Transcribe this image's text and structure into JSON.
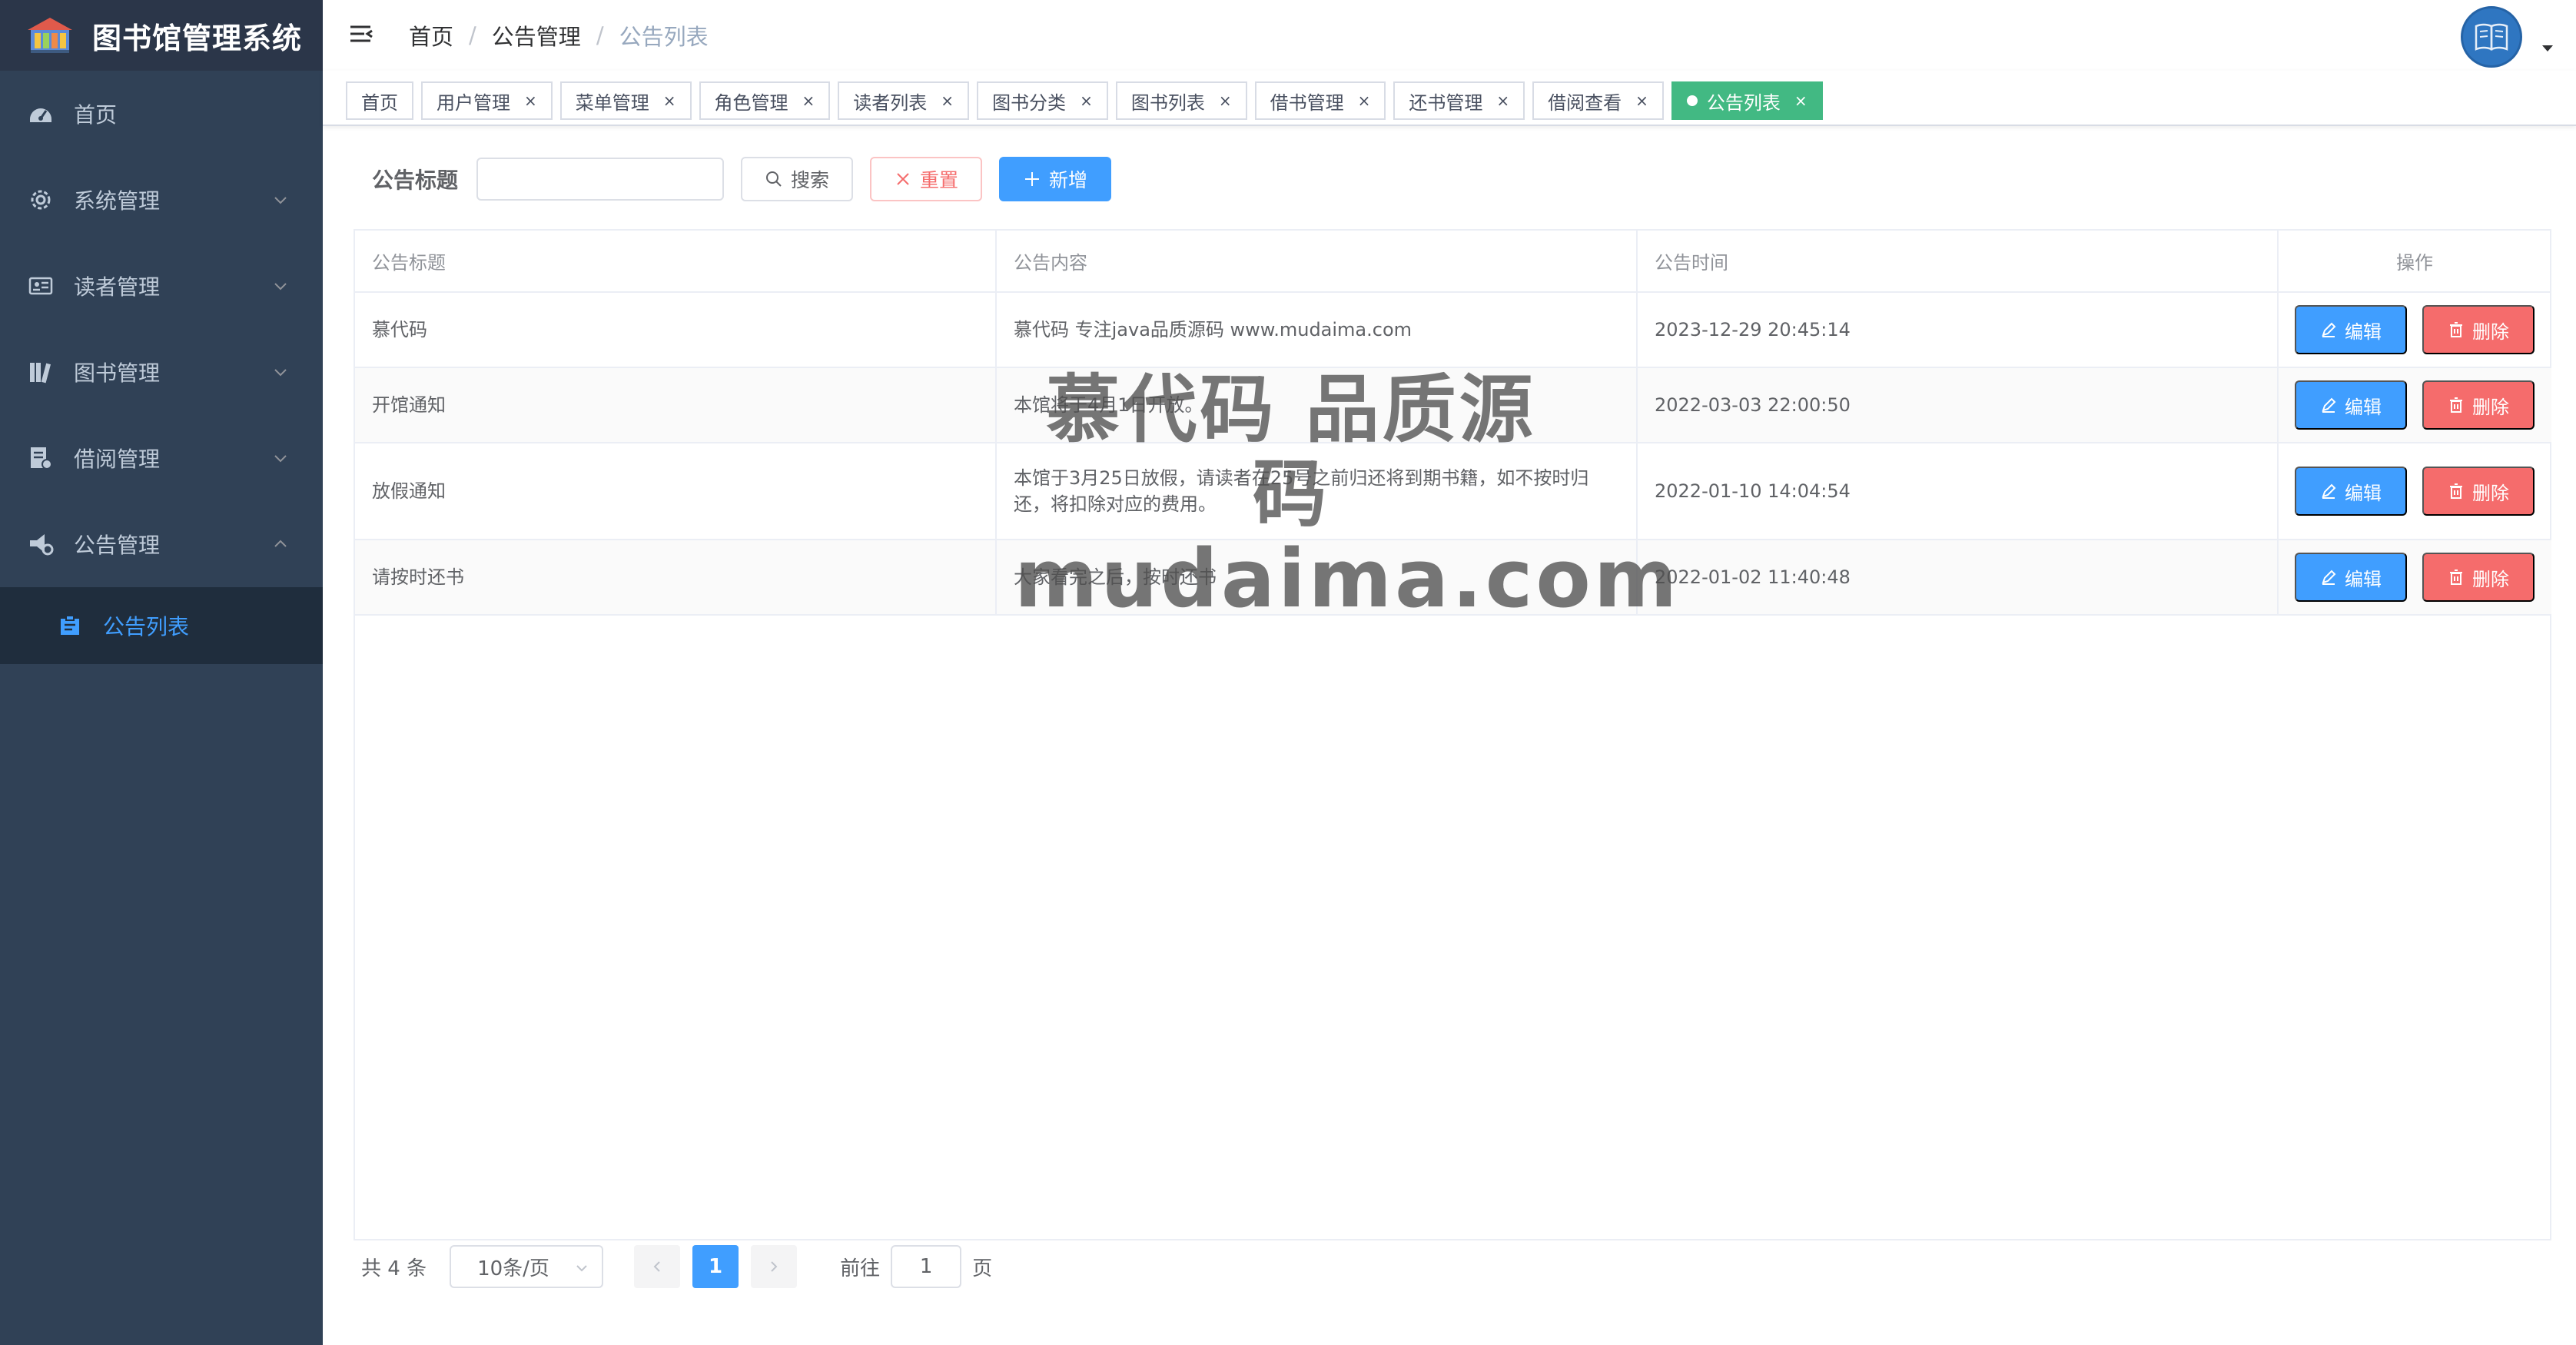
{
  "app": {
    "title": "图书馆管理系统"
  },
  "sidebar": {
    "items": [
      {
        "label": "首页",
        "icon": "dashboard-icon"
      },
      {
        "label": "系统管理",
        "icon": "gear-icon"
      },
      {
        "label": "读者管理",
        "icon": "id-card-icon"
      },
      {
        "label": "图书管理",
        "icon": "books-icon"
      },
      {
        "label": "借阅管理",
        "icon": "borrow-icon"
      },
      {
        "label": "公告管理",
        "icon": "announcement-icon"
      }
    ],
    "subitem": {
      "label": "公告列表",
      "icon": "clipboard-icon"
    }
  },
  "breadcrumb": {
    "home": "首页",
    "section": "公告管理",
    "current": "公告列表",
    "separator": "/"
  },
  "tags": [
    {
      "label": "首页"
    },
    {
      "label": "用户管理"
    },
    {
      "label": "菜单管理"
    },
    {
      "label": "角色管理"
    },
    {
      "label": "读者列表"
    },
    {
      "label": "图书分类"
    },
    {
      "label": "图书列表"
    },
    {
      "label": "借书管理"
    },
    {
      "label": "还书管理"
    },
    {
      "label": "借阅查看"
    },
    {
      "label": "公告列表"
    }
  ],
  "tag_close": "×",
  "search": {
    "label": "公告标题",
    "value": "",
    "search_btn": "搜索",
    "reset_btn": "重置",
    "add_btn": "新增"
  },
  "table": {
    "headers": {
      "title": "公告标题",
      "content": "公告内容",
      "time": "公告时间",
      "op": "操作"
    },
    "rows": [
      {
        "title": "慕代码",
        "content": "慕代码 专注java品质源码 www.mudaima.com",
        "time": "2023-12-29 20:45:14"
      },
      {
        "title": "开馆通知",
        "content": "本馆将于4月1日开放。",
        "time": "2022-03-03 22:00:50"
      },
      {
        "title": "放假通知",
        "content": "本馆于3月25日放假，请读者在25号之前归还将到期书籍，如不按时归还，将扣除对应的费用。",
        "time": "2022-01-10 14:04:54"
      },
      {
        "title": "请按时还书",
        "content": "大家看完之后，按时还书",
        "time": "2022-01-02 11:40:48"
      }
    ],
    "edit_label": "编辑",
    "delete_label": "删除"
  },
  "watermark": {
    "line1": "慕代码 品质源码",
    "line2": "mudaima.com"
  },
  "pagination": {
    "total": "共 4 条",
    "page_size": "10条/页",
    "current_page": "1",
    "goto_prefix": "前往",
    "goto_value": "1",
    "goto_suffix": "页"
  },
  "colors": {
    "sidebar_bg": "#304156",
    "primary": "#409eff",
    "danger": "#f56c6c",
    "active_tag": "#42b983"
  }
}
